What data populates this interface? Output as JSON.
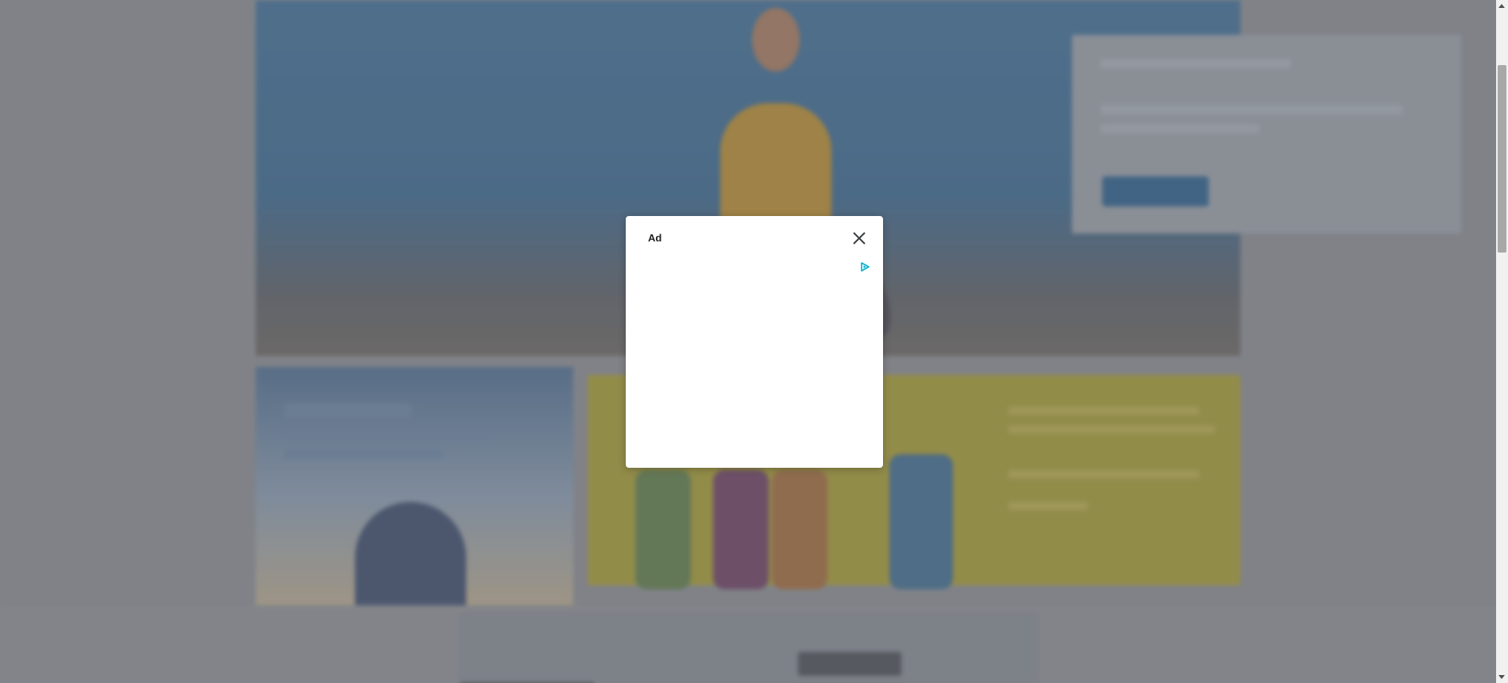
{
  "modal": {
    "title": "Ad",
    "close_icon": "close-icon",
    "adchoices_icon": "adchoices-icon"
  },
  "colors": {
    "overlay": "#6e7076",
    "modal_bg": "#ffffff",
    "adchoices": "#00aecd",
    "hero_blue": "#3f6e97",
    "panel_yellow": "#a79b32"
  }
}
